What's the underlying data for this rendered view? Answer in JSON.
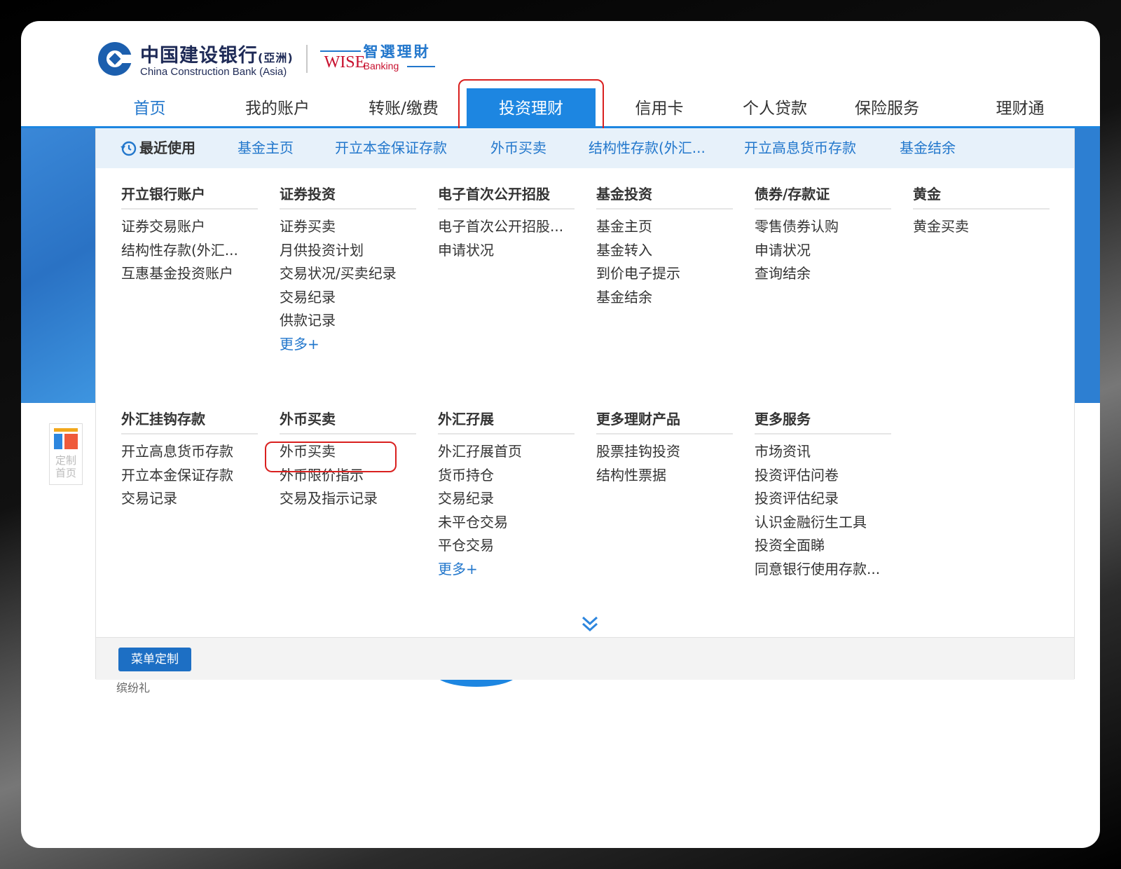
{
  "logo": {
    "bank_cn": "中国建设银行",
    "bank_cn_suffix": "(亞洲)",
    "bank_en": "China Construction Bank (Asia)",
    "wise_cn": "智選理財",
    "wise_en": "WISE",
    "wise_banking": "Banking"
  },
  "topnav": [
    "首页",
    "我的账户",
    "转账/缴费",
    "投资理财",
    "信用卡",
    "个人贷款",
    "保险服务",
    "理财通"
  ],
  "recent": {
    "title": "最近使用",
    "items": [
      "基金主页",
      "开立本金保证存款",
      "外币买卖",
      "结构性存款(外汇...",
      "开立高息货币存款",
      "基金结余"
    ]
  },
  "menu_top": [
    {
      "heading": "开立银行账户",
      "links": [
        "证券交易账户",
        "结构性存款(外汇...",
        "互惠基金投资账户"
      ]
    },
    {
      "heading": "证券投资",
      "links": [
        "证券买卖",
        "月供投资计划",
        "交易状况/买卖纪录",
        "交易纪录",
        "供款记录"
      ],
      "more": "更多+"
    },
    {
      "heading": "电子首次公开招股",
      "links": [
        "电子首次公开招股...",
        "申请状况"
      ]
    },
    {
      "heading": "基金投资",
      "links": [
        "基金主页",
        "基金转入",
        "到价电子提示",
        "基金结余"
      ]
    },
    {
      "heading": "债券/存款证",
      "links": [
        "零售债券认购",
        "申请状况",
        "查询结余"
      ]
    },
    {
      "heading": "黄金",
      "links": [
        "黄金买卖"
      ]
    }
  ],
  "menu_bottom": [
    {
      "heading": "外汇挂钩存款",
      "links": [
        "开立高息货币存款",
        "开立本金保证存款",
        "交易记录"
      ]
    },
    {
      "heading": "外币买卖",
      "links": [
        "外币买卖",
        "外币限价指示",
        "交易及指示记录"
      ]
    },
    {
      "heading": "外汇孖展",
      "links": [
        "外汇孖展首页",
        "货币持仓",
        "交易纪录",
        "未平仓交易",
        "平仓交易"
      ],
      "more": "更多+"
    },
    {
      "heading": "更多理财产品",
      "links": [
        "股票挂钩投资",
        "结构性票据"
      ]
    },
    {
      "heading": "更多服务",
      "links": [
        "市场资讯",
        "投资评估问卷",
        "投资评估纪录",
        "认识金融衍生工具",
        "投资全面睇",
        "同意银行使用存款..."
      ]
    }
  ],
  "footer": {
    "custom_menu": "菜单定制"
  },
  "side": {
    "custom_home_1": "定制",
    "custom_home_2": "首页"
  },
  "peek_text": "缤纷礼",
  "colors": {
    "accent": "#1d86e1",
    "highlight_box": "#d9201f",
    "link": "#2277cc"
  }
}
